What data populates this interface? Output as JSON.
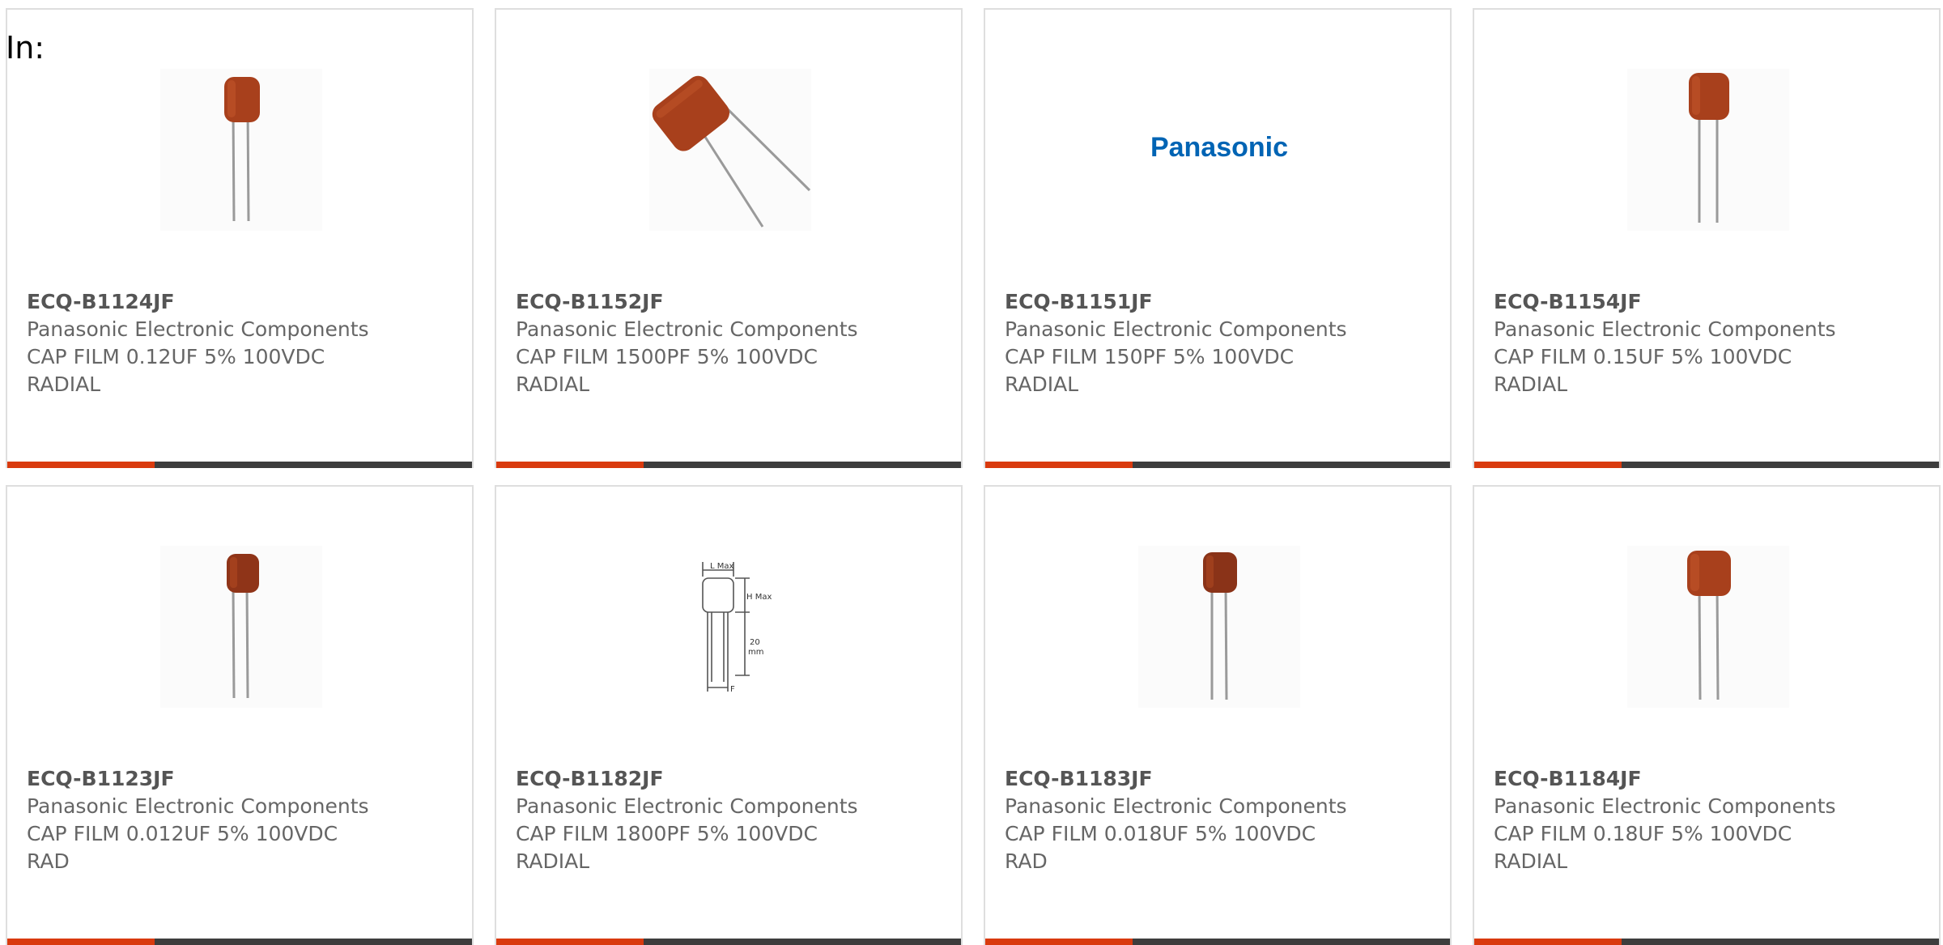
{
  "header": {
    "label": "In:"
  },
  "colors": {
    "accent": "#d93a0e",
    "bar": "#3d3d3d",
    "capacitor": "#a8401c",
    "brand": "#0064b4"
  },
  "products": [
    {
      "part": "ECQ-B1124JF",
      "manufacturer": "Panasonic Electronic Components",
      "desc1": "CAP FILM 0.12UF 5% 100VDC",
      "desc2": "RADIAL",
      "image": "capacitor-photo"
    },
    {
      "part": "ECQ-B1152JF",
      "manufacturer": "Panasonic Electronic Components",
      "desc1": "CAP FILM 1500PF 5% 100VDC",
      "desc2": "RADIAL",
      "image": "capacitor-tilted-photo"
    },
    {
      "part": "ECQ-B1151JF",
      "manufacturer": "Panasonic Electronic Components",
      "desc1": "CAP FILM 150PF 5% 100VDC",
      "desc2": "RADIAL",
      "image": "panasonic-logo",
      "logo_text": "Panasonic"
    },
    {
      "part": "ECQ-B1154JF",
      "manufacturer": "Panasonic Electronic Components",
      "desc1": "CAP FILM 0.15UF 5% 100VDC",
      "desc2": "RADIAL",
      "image": "capacitor-photo"
    },
    {
      "part": "ECQ-B1123JF",
      "manufacturer": "Panasonic Electronic Components",
      "desc1": "CAP FILM 0.012UF 5% 100VDC",
      "desc2": "RAD",
      "image": "capacitor-photo"
    },
    {
      "part": "ECQ-B1182JF",
      "manufacturer": "Panasonic Electronic Components",
      "desc1": "CAP FILM 1800PF 5% 100VDC",
      "desc2": "RADIAL",
      "image": "dimension-drawing",
      "drawing_labels": [
        "L Max",
        "H Max",
        "20",
        "mm",
        "F"
      ]
    },
    {
      "part": "ECQ-B1183JF",
      "manufacturer": "Panasonic Electronic Components",
      "desc1": "CAP FILM 0.018UF 5% 100VDC",
      "desc2": "RAD",
      "image": "capacitor-photo"
    },
    {
      "part": "ECQ-B1184JF",
      "manufacturer": "Panasonic Electronic Components",
      "desc1": "CAP FILM 0.18UF 5% 100VDC",
      "desc2": "RADIAL",
      "image": "capacitor-photo"
    }
  ]
}
